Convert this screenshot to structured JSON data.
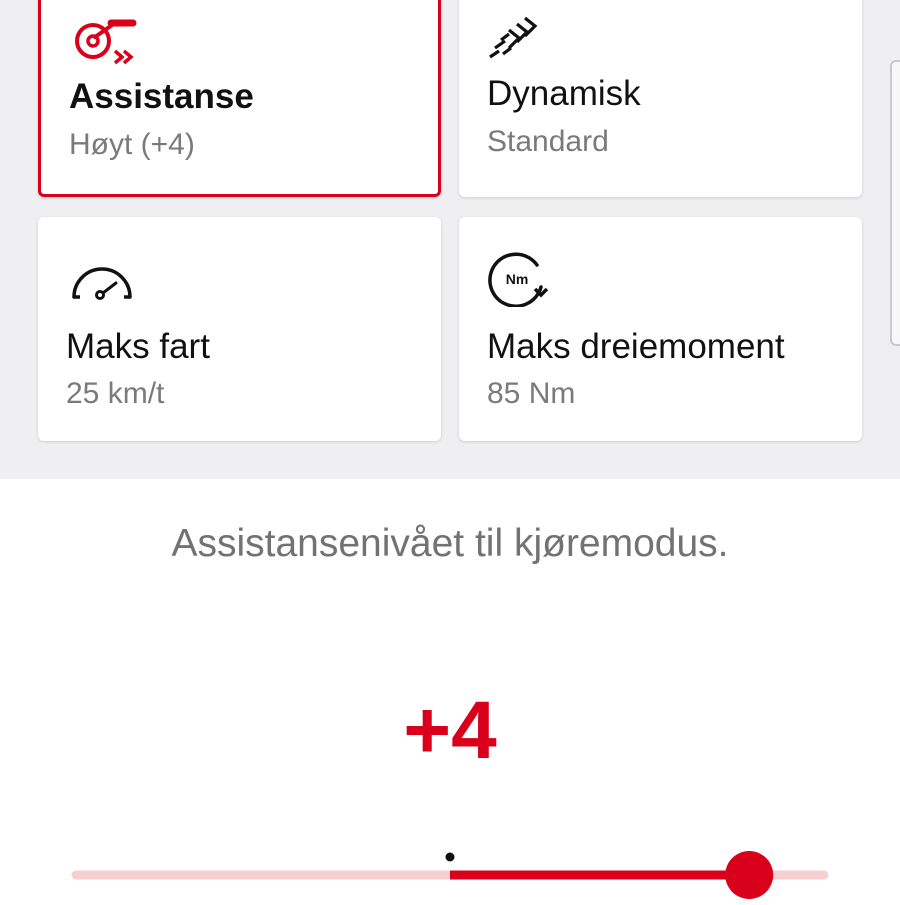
{
  "cards": [
    {
      "id": "assistance",
      "icon": "assist-motor-icon",
      "title": "Assistanse",
      "value": "Høyt (+4)",
      "selected": true
    },
    {
      "id": "dynamic",
      "icon": "dynamic-wind-icon",
      "title": "Dynamisk",
      "value": "Standard",
      "selected": false
    },
    {
      "id": "max-speed",
      "icon": "speedometer-icon",
      "title": "Maks fart",
      "value": "25 km/t",
      "selected": false
    },
    {
      "id": "max-torque",
      "icon": "torque-nm-icon",
      "title": "Maks dreiemoment",
      "value": "85 Nm",
      "selected": false
    }
  ],
  "torque_icon_label": "Nm",
  "description": "Assistansenivået til kjøremodus.",
  "assist_level": {
    "display": "+4",
    "value": 4,
    "min": -5,
    "max": 5,
    "center": 0
  },
  "colors": {
    "accent": "#d9001b",
    "track_light": "#f6cfd3",
    "panel_background": "#efeff1"
  }
}
